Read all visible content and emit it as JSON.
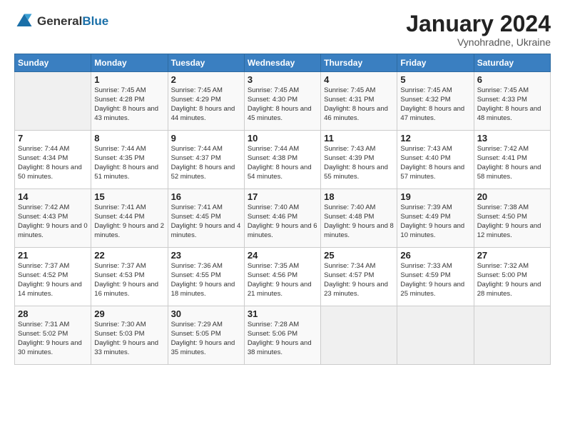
{
  "logo": {
    "general": "General",
    "blue": "Blue"
  },
  "header": {
    "month_year": "January 2024",
    "location": "Vynohradne, Ukraine"
  },
  "days_of_week": [
    "Sunday",
    "Monday",
    "Tuesday",
    "Wednesday",
    "Thursday",
    "Friday",
    "Saturday"
  ],
  "weeks": [
    [
      {
        "day": "",
        "empty": true
      },
      {
        "day": "1",
        "sunrise": "7:45 AM",
        "sunset": "4:28 PM",
        "daylight": "8 hours and 43 minutes."
      },
      {
        "day": "2",
        "sunrise": "7:45 AM",
        "sunset": "4:29 PM",
        "daylight": "8 hours and 44 minutes."
      },
      {
        "day": "3",
        "sunrise": "7:45 AM",
        "sunset": "4:30 PM",
        "daylight": "8 hours and 45 minutes."
      },
      {
        "day": "4",
        "sunrise": "7:45 AM",
        "sunset": "4:31 PM",
        "daylight": "8 hours and 46 minutes."
      },
      {
        "day": "5",
        "sunrise": "7:45 AM",
        "sunset": "4:32 PM",
        "daylight": "8 hours and 47 minutes."
      },
      {
        "day": "6",
        "sunrise": "7:45 AM",
        "sunset": "4:33 PM",
        "daylight": "8 hours and 48 minutes."
      }
    ],
    [
      {
        "day": "7",
        "sunrise": "7:44 AM",
        "sunset": "4:34 PM",
        "daylight": "8 hours and 50 minutes."
      },
      {
        "day": "8",
        "sunrise": "7:44 AM",
        "sunset": "4:35 PM",
        "daylight": "8 hours and 51 minutes."
      },
      {
        "day": "9",
        "sunrise": "7:44 AM",
        "sunset": "4:37 PM",
        "daylight": "8 hours and 52 minutes."
      },
      {
        "day": "10",
        "sunrise": "7:44 AM",
        "sunset": "4:38 PM",
        "daylight": "8 hours and 54 minutes."
      },
      {
        "day": "11",
        "sunrise": "7:43 AM",
        "sunset": "4:39 PM",
        "daylight": "8 hours and 55 minutes."
      },
      {
        "day": "12",
        "sunrise": "7:43 AM",
        "sunset": "4:40 PM",
        "daylight": "8 hours and 57 minutes."
      },
      {
        "day": "13",
        "sunrise": "7:42 AM",
        "sunset": "4:41 PM",
        "daylight": "8 hours and 58 minutes."
      }
    ],
    [
      {
        "day": "14",
        "sunrise": "7:42 AM",
        "sunset": "4:43 PM",
        "daylight": "9 hours and 0 minutes."
      },
      {
        "day": "15",
        "sunrise": "7:41 AM",
        "sunset": "4:44 PM",
        "daylight": "9 hours and 2 minutes."
      },
      {
        "day": "16",
        "sunrise": "7:41 AM",
        "sunset": "4:45 PM",
        "daylight": "9 hours and 4 minutes."
      },
      {
        "day": "17",
        "sunrise": "7:40 AM",
        "sunset": "4:46 PM",
        "daylight": "9 hours and 6 minutes."
      },
      {
        "day": "18",
        "sunrise": "7:40 AM",
        "sunset": "4:48 PM",
        "daylight": "9 hours and 8 minutes."
      },
      {
        "day": "19",
        "sunrise": "7:39 AM",
        "sunset": "4:49 PM",
        "daylight": "9 hours and 10 minutes."
      },
      {
        "day": "20",
        "sunrise": "7:38 AM",
        "sunset": "4:50 PM",
        "daylight": "9 hours and 12 minutes."
      }
    ],
    [
      {
        "day": "21",
        "sunrise": "7:37 AM",
        "sunset": "4:52 PM",
        "daylight": "9 hours and 14 minutes."
      },
      {
        "day": "22",
        "sunrise": "7:37 AM",
        "sunset": "4:53 PM",
        "daylight": "9 hours and 16 minutes."
      },
      {
        "day": "23",
        "sunrise": "7:36 AM",
        "sunset": "4:55 PM",
        "daylight": "9 hours and 18 minutes."
      },
      {
        "day": "24",
        "sunrise": "7:35 AM",
        "sunset": "4:56 PM",
        "daylight": "9 hours and 21 minutes."
      },
      {
        "day": "25",
        "sunrise": "7:34 AM",
        "sunset": "4:57 PM",
        "daylight": "9 hours and 23 minutes."
      },
      {
        "day": "26",
        "sunrise": "7:33 AM",
        "sunset": "4:59 PM",
        "daylight": "9 hours and 25 minutes."
      },
      {
        "day": "27",
        "sunrise": "7:32 AM",
        "sunset": "5:00 PM",
        "daylight": "9 hours and 28 minutes."
      }
    ],
    [
      {
        "day": "28",
        "sunrise": "7:31 AM",
        "sunset": "5:02 PM",
        "daylight": "9 hours and 30 minutes."
      },
      {
        "day": "29",
        "sunrise": "7:30 AM",
        "sunset": "5:03 PM",
        "daylight": "9 hours and 33 minutes."
      },
      {
        "day": "30",
        "sunrise": "7:29 AM",
        "sunset": "5:05 PM",
        "daylight": "9 hours and 35 minutes."
      },
      {
        "day": "31",
        "sunrise": "7:28 AM",
        "sunset": "5:06 PM",
        "daylight": "9 hours and 38 minutes."
      },
      {
        "day": "",
        "empty": true
      },
      {
        "day": "",
        "empty": true
      },
      {
        "day": "",
        "empty": true
      }
    ]
  ]
}
